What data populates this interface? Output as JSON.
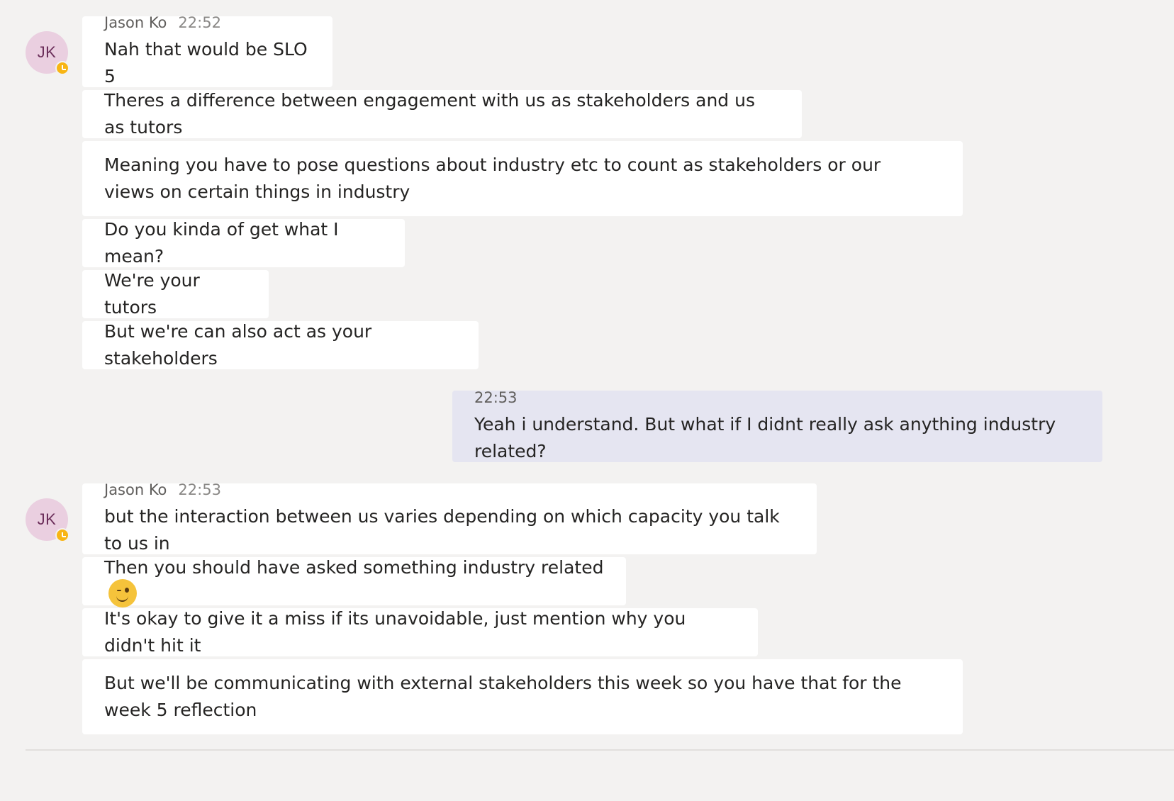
{
  "groups": [
    {
      "sender": "Jason Ko",
      "initials": "JK",
      "time": "22:52",
      "messages": [
        "Nah that would be SLO 5",
        "Theres a difference between engagement with us as stakeholders and us as tutors",
        "Meaning you have to pose questions about industry etc to count as stakeholders or our views on certain things in industry",
        "Do you kinda of get what I mean?",
        "We're your tutors",
        "But we're can also act as your stakeholders"
      ]
    },
    {
      "self": true,
      "time": "22:53",
      "messages": [
        "Yeah i understand. But what if I didnt really ask anything industry related?"
      ]
    },
    {
      "sender": "Jason Ko",
      "initials": "JK",
      "time": "22:53",
      "messages": [
        "but the interaction between us varies depending on which capacity you talk to us in",
        "Then you should have asked something industry related",
        "It's okay to give it a miss if its unavoidable, just mention why you didn't hit it",
        "But we'll be communicating with external stakeholders this week so you have that for the week 5 reflection"
      ]
    }
  ],
  "icons": {
    "presence": "away-clock-icon",
    "emoji": "wink-emoji-icon"
  },
  "colors": {
    "background": "#f3f2f1",
    "incoming_bubble": "#ffffff",
    "outgoing_bubble": "#e5e5f1",
    "avatar": "#eacfe0",
    "presence_away": "#f8b514"
  }
}
